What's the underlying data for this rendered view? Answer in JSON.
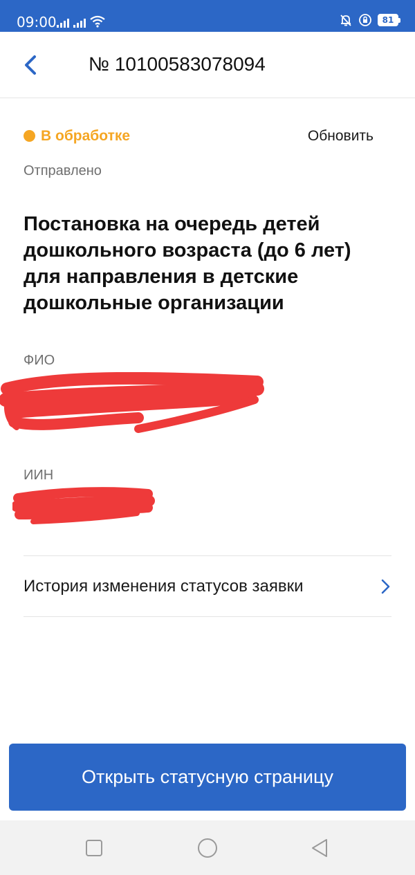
{
  "status_bar": {
    "time": "09:00",
    "battery": "81",
    "icons": [
      "signal-icon",
      "signal-icon",
      "wifi-icon",
      "mute-icon",
      "lock-rotation-icon",
      "battery-icon"
    ]
  },
  "header": {
    "title": "№ 10100583078094",
    "back_icon": "chevron-left-icon"
  },
  "application": {
    "status": "В обработке",
    "status_color": "#f5a623",
    "refresh_label": "Обновить",
    "sent_label": "Отправлено",
    "service_title": "Постановка на очередь детей дошкольного возраста (до 6 лет) для направления в детские дошкольные организации",
    "fio_label": "ФИО",
    "iin_label": "ИИН",
    "history_label": "История изменения статусов заявки",
    "open_button_label": "Открыть статусную страницу"
  },
  "colors": {
    "primary": "#2c67c6",
    "status": "#f5a623",
    "redaction": "#ee3a3a"
  },
  "nav_bar": {
    "icons": [
      "recent-apps-icon",
      "home-icon",
      "back-icon"
    ]
  }
}
